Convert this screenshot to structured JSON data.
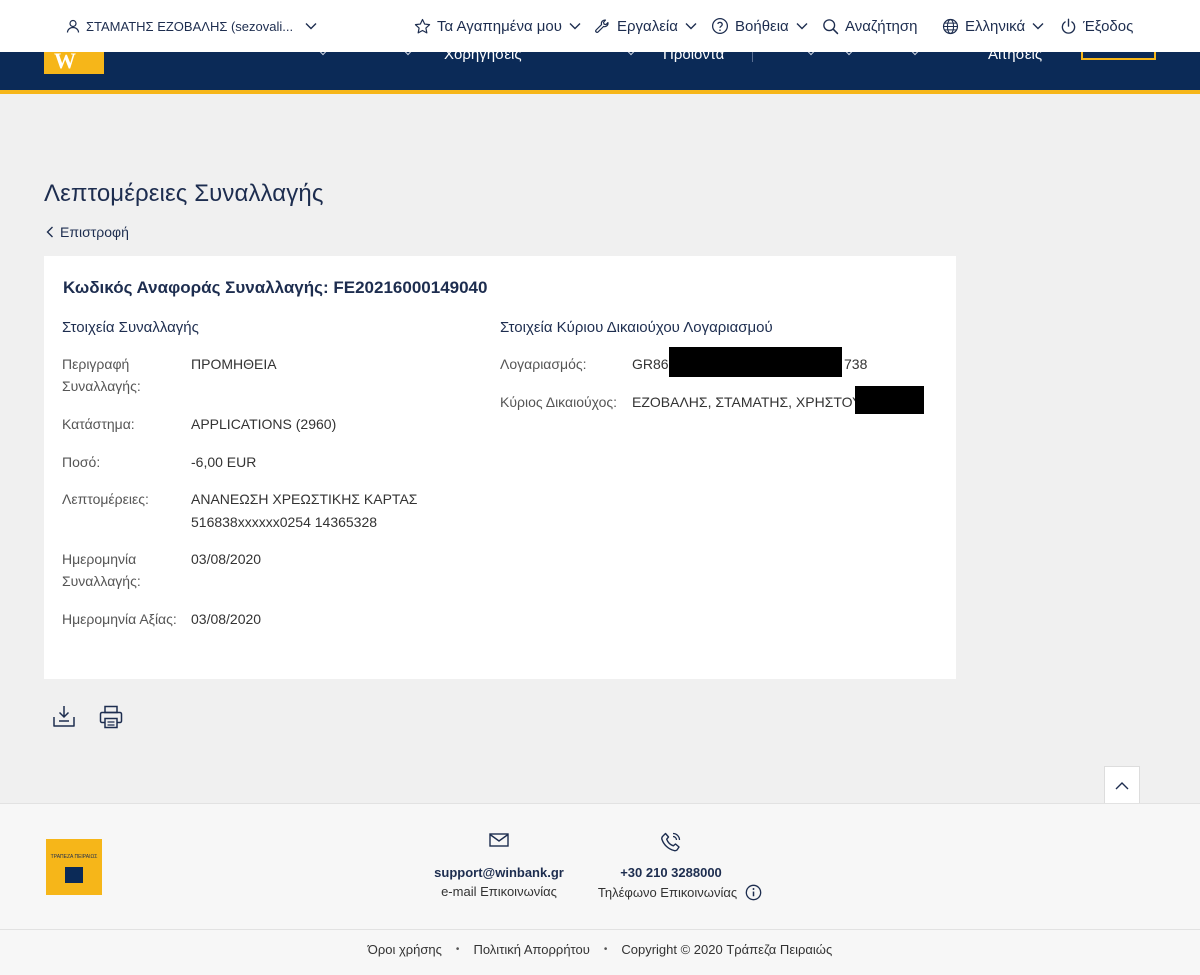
{
  "topbar": {
    "user": "ΣΤΑΜΑΤΗΣ ΕΖΟΒΑΛΗΣ (sezovali...",
    "favorites": "Τα Αγαπημένα μου",
    "tools": "Εργαλεία",
    "help": "Βοήθεια",
    "search": "Αναζήτηση",
    "language": "Ελληνικά",
    "logout": "Έξοδος"
  },
  "nav": {
    "item_sponsorships": "Χορηγήσεις",
    "item_products": "Προϊόντα",
    "item_requests": "Αιτήσεις"
  },
  "page": {
    "title": "Λεπτομέρειες Συναλλαγής",
    "back": "Επιστροφή"
  },
  "transaction": {
    "ref_label": "Κωδικός Αναφοράς Συναλλαγής:",
    "ref_value": "FE20216000149040",
    "section_title": "Στοιχεία Συναλλαγής",
    "rows": [
      {
        "label": "Περιγραφή Συναλλαγής:",
        "value": "ΠΡΟΜΗΘΕΙΑ"
      },
      {
        "label": "Κατάστημα:",
        "value": "APPLICATIONS (2960)"
      },
      {
        "label": "Ποσό:",
        "value": "-6,00 EUR"
      },
      {
        "label": "Λεπτομέρειες:",
        "value_line1": "ΑΝΑΝΕΩΣΗ ΧΡΕΩΣΤΙΚΗΣ ΚΑΡΤΑΣ",
        "value_line2": "516838xxxxxx0254 14365328"
      },
      {
        "label": "Ημερομηνία Συναλλαγής:",
        "value": "03/08/2020"
      },
      {
        "label": "Ημερομηνία Αξίας:",
        "value": "03/08/2020"
      }
    ]
  },
  "owner": {
    "section_title": "Στοιχεία Κύριου Δικαιούχου Λογαριασμού",
    "account_label": "Λογαριασμός:",
    "account_prefix": "GR86",
    "account_suffix": "738",
    "holder_label": "Κύριος Δικαιούχος:",
    "holder_value": "ΕΖΟΒΑΛΗΣ, ΣΤΑΜΑΤΗΣ, ΧΡΗΣΤΟΥ,"
  },
  "footer": {
    "bank_logo_text": "ΤΡΑΠΕΖΑ ΠΕΙΡΑΙΩΣ",
    "email_value": "support@winbank.gr",
    "email_label": "e-mail Επικοινωνίας",
    "phone_value": "+30 210 3288000",
    "phone_label": "Τηλέφωνο Επικοινωνίας",
    "terms": "Όροι χρήσης",
    "privacy": "Πολιτική Απορρήτου",
    "copyright": "Copyright © 2020 Τράπεζα Πειραιώς"
  },
  "colors": {
    "navy": "#0b2a57",
    "gold": "#f6b619",
    "text": "#1d2d4f"
  },
  "icons": {
    "user": "user-icon",
    "favorites": "star-icon",
    "tools": "wrench-icon",
    "help": "question-circle-icon",
    "search": "search-icon",
    "language": "globe-icon",
    "logout": "power-icon",
    "download": "download-icon",
    "print": "print-icon",
    "email": "envelope-icon",
    "phone": "phone-icon",
    "info": "info-icon",
    "scroll_top": "chevron-up-icon"
  }
}
